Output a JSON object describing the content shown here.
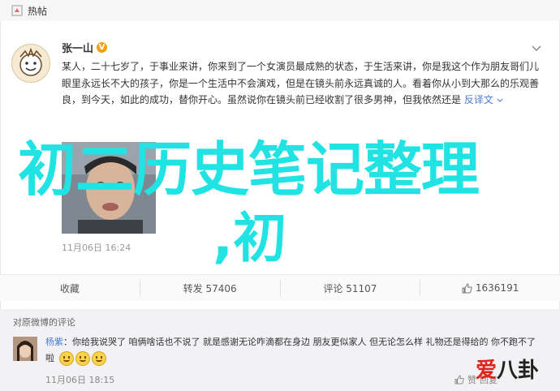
{
  "topbar": {
    "title": "热帖"
  },
  "post": {
    "username": "张一山",
    "badge": "V",
    "body": "某人，二十七岁了，于事业来讲，你来到了一个女演员最成熟的状态，于生活来讲，你是我这个作为朋友哥们儿眼里永远长不大的孩子，你是一个生活中不会演戏，但是在镜头前永远真诚的人。看着你从小到大那么的乐观善良，到今天，如此的成功，替你开心。虽然说你在镜头前已经收割了很多男神，但我依然还是",
    "translate": "反译文",
    "timestamp": "11月06日 16:24"
  },
  "actions": [
    {
      "label": "收藏"
    },
    {
      "label": "转发 57406"
    },
    {
      "label": "评论 51107"
    },
    {
      "label": "1636191"
    }
  ],
  "comments": {
    "title": "对原微博的评论",
    "user": "杨紫",
    "text": "：你给我说哭了 咱俩啥话也不说了 就是感谢无论咋滴都在身边 朋友更似家人 但无论怎么样 礼物还是得给的 你不跑不了啦",
    "time": "11月06日 18:15",
    "like_label": "赞",
    "reply_label": "回复"
  },
  "overlay": {
    "title": "初二历史笔记整理",
    "sub": ",初"
  },
  "watermark": {
    "prefix": "爱",
    "rest": "八卦"
  },
  "colors": {
    "overlay": "#22e3e3",
    "link": "#4b7bd6",
    "badge": "#f0a30a"
  }
}
